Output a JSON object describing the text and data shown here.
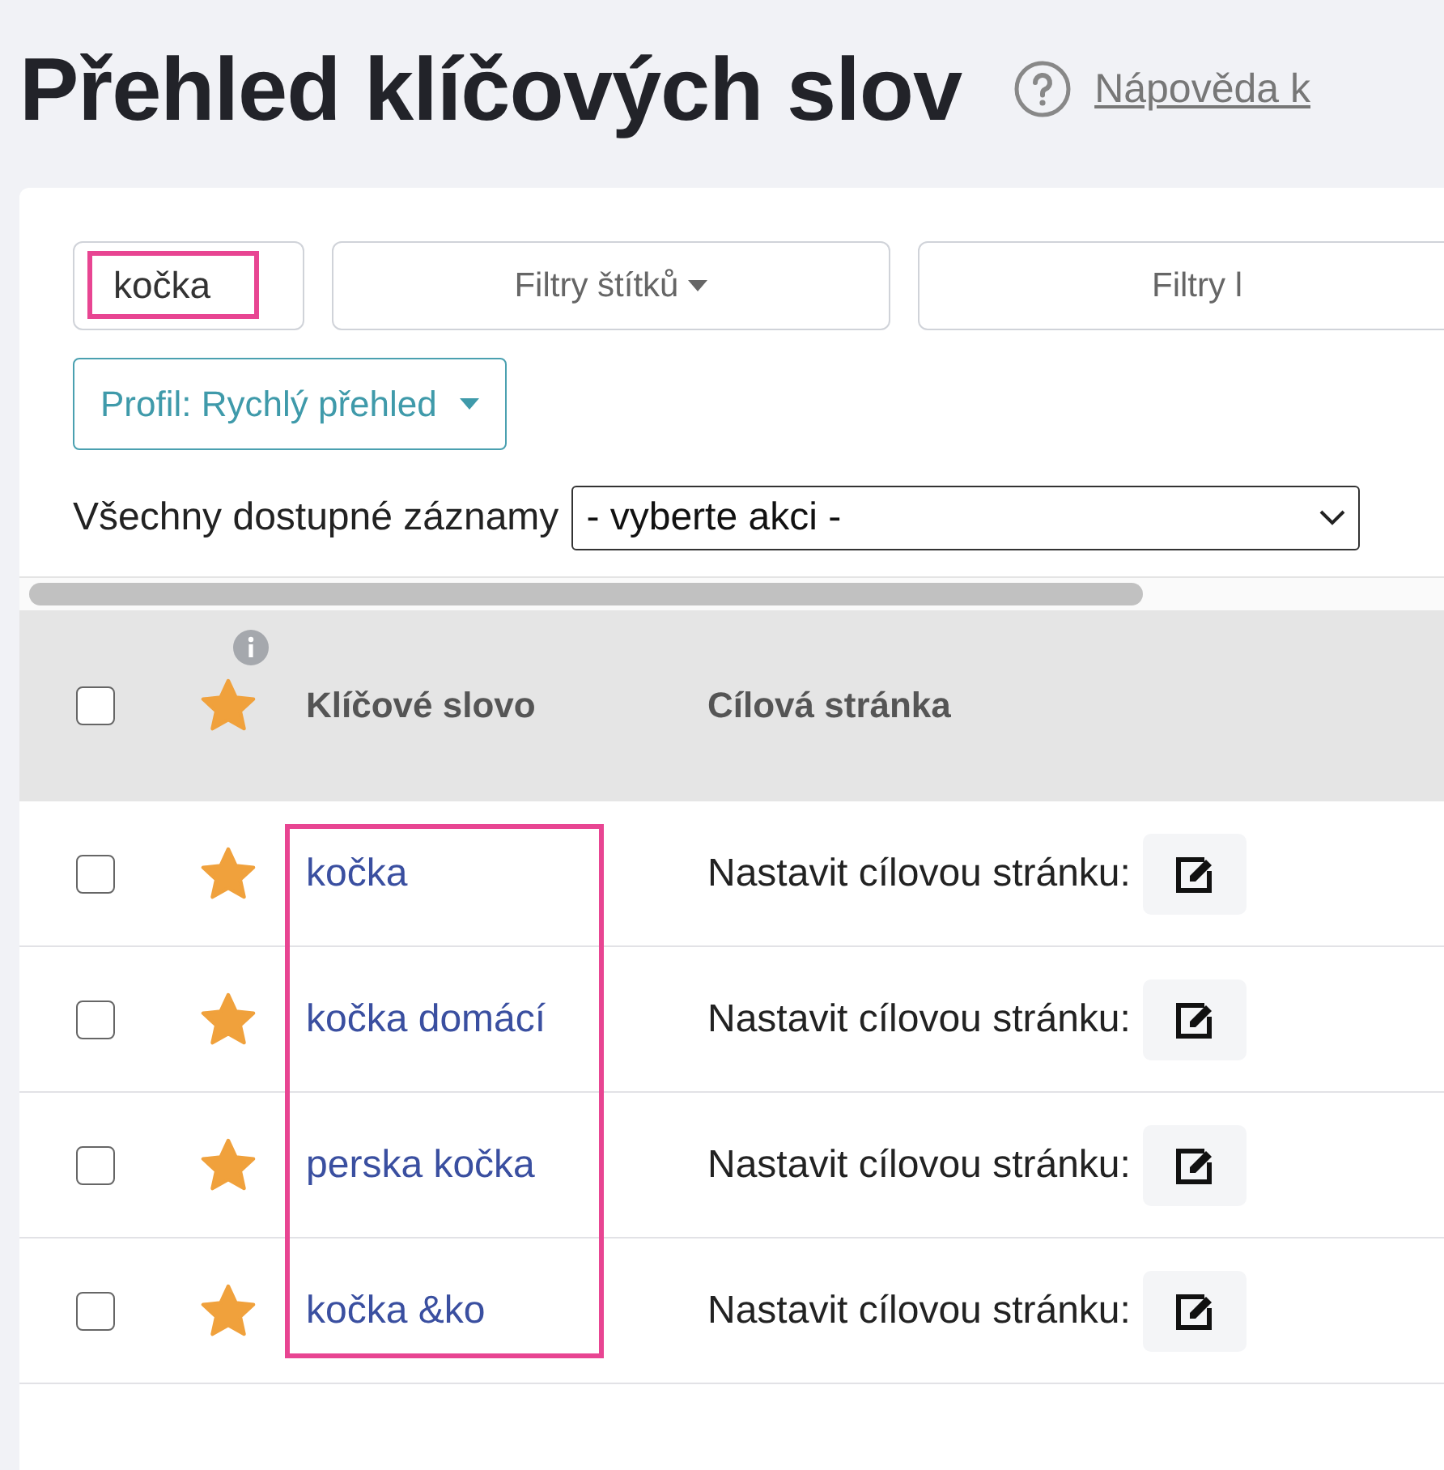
{
  "title": "Přehled klíčových slov",
  "help": {
    "label": "Nápověda k"
  },
  "search": {
    "value": "kočka",
    "highlighted": true
  },
  "filters": [
    {
      "label": "Filtry štítků",
      "caret": true
    },
    {
      "label": "Filtry l",
      "caret": false
    }
  ],
  "profile": {
    "label": "Profil: Rychlý přehled"
  },
  "bulk": {
    "label": "Všechny dostupné záznamy",
    "select": "- vyberte akci -"
  },
  "table": {
    "header_checked": false,
    "columns": [
      "Klíčové slovo",
      "Cílová stránka"
    ],
    "keyword_column_highlighted": true,
    "rows": [
      {
        "checked": false,
        "keyword": "kočka",
        "target": "Nastavit cílovou stránku:"
      },
      {
        "checked": false,
        "keyword": "kočka domácí",
        "target": "Nastavit cílovou stránku:"
      },
      {
        "checked": false,
        "keyword": "perska kočka",
        "target": "Nastavit cílovou stránku:"
      },
      {
        "checked": false,
        "keyword": "kočka &ko",
        "target": "Nastavit cílovou stránku:"
      }
    ]
  }
}
